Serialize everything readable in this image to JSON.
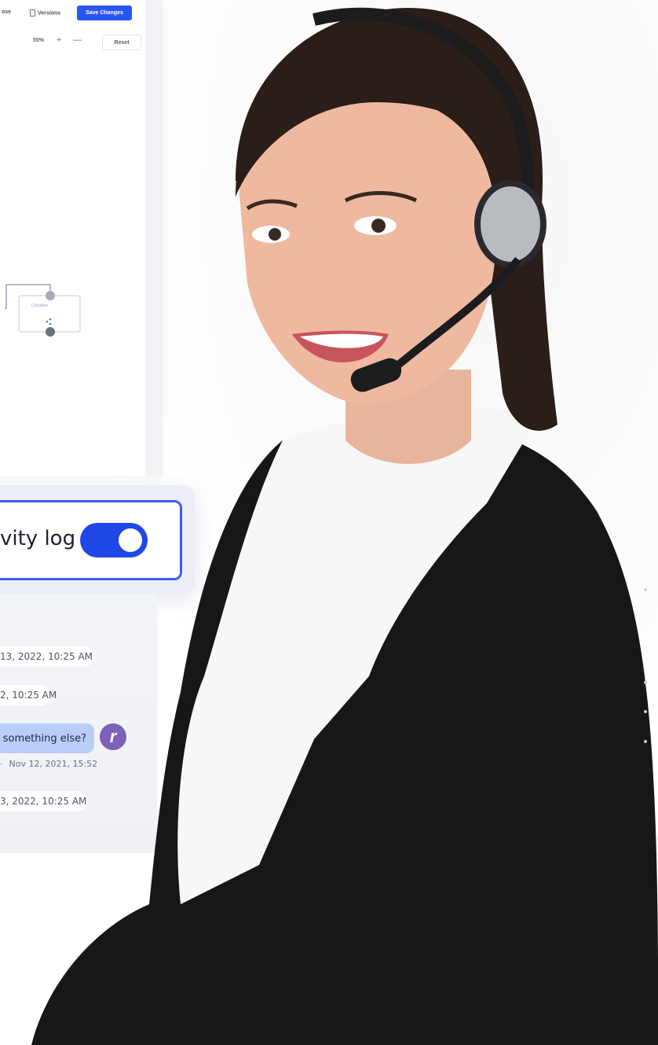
{
  "editor": {
    "toolbar": {
      "partial_label": "ose",
      "versions_label": "Versions",
      "save_label": "Save Changes"
    },
    "zoom": {
      "level": "55%",
      "plus": "+",
      "minus": "—",
      "reset_label": "Reset"
    },
    "flow": {
      "condition_label": "Condition"
    }
  },
  "activity": {
    "toggle_label": "vity log",
    "toggle_on": true
  },
  "log": {
    "entries": [
      {
        "text": "13, 2022, 10:25 AM"
      },
      {
        "text": "2, 10:25 AM"
      },
      {
        "text": "3, 2022, 10:25 AM"
      }
    ],
    "message": {
      "text": "something else?",
      "time": "Nov 12, 2021, 15:52",
      "avatar_letter": "r"
    }
  },
  "colors": {
    "accent": "#2a56f5",
    "toggle": "#1f47e6",
    "message_bubble": "#b9cdf7",
    "avatar": "#7b62b8"
  }
}
